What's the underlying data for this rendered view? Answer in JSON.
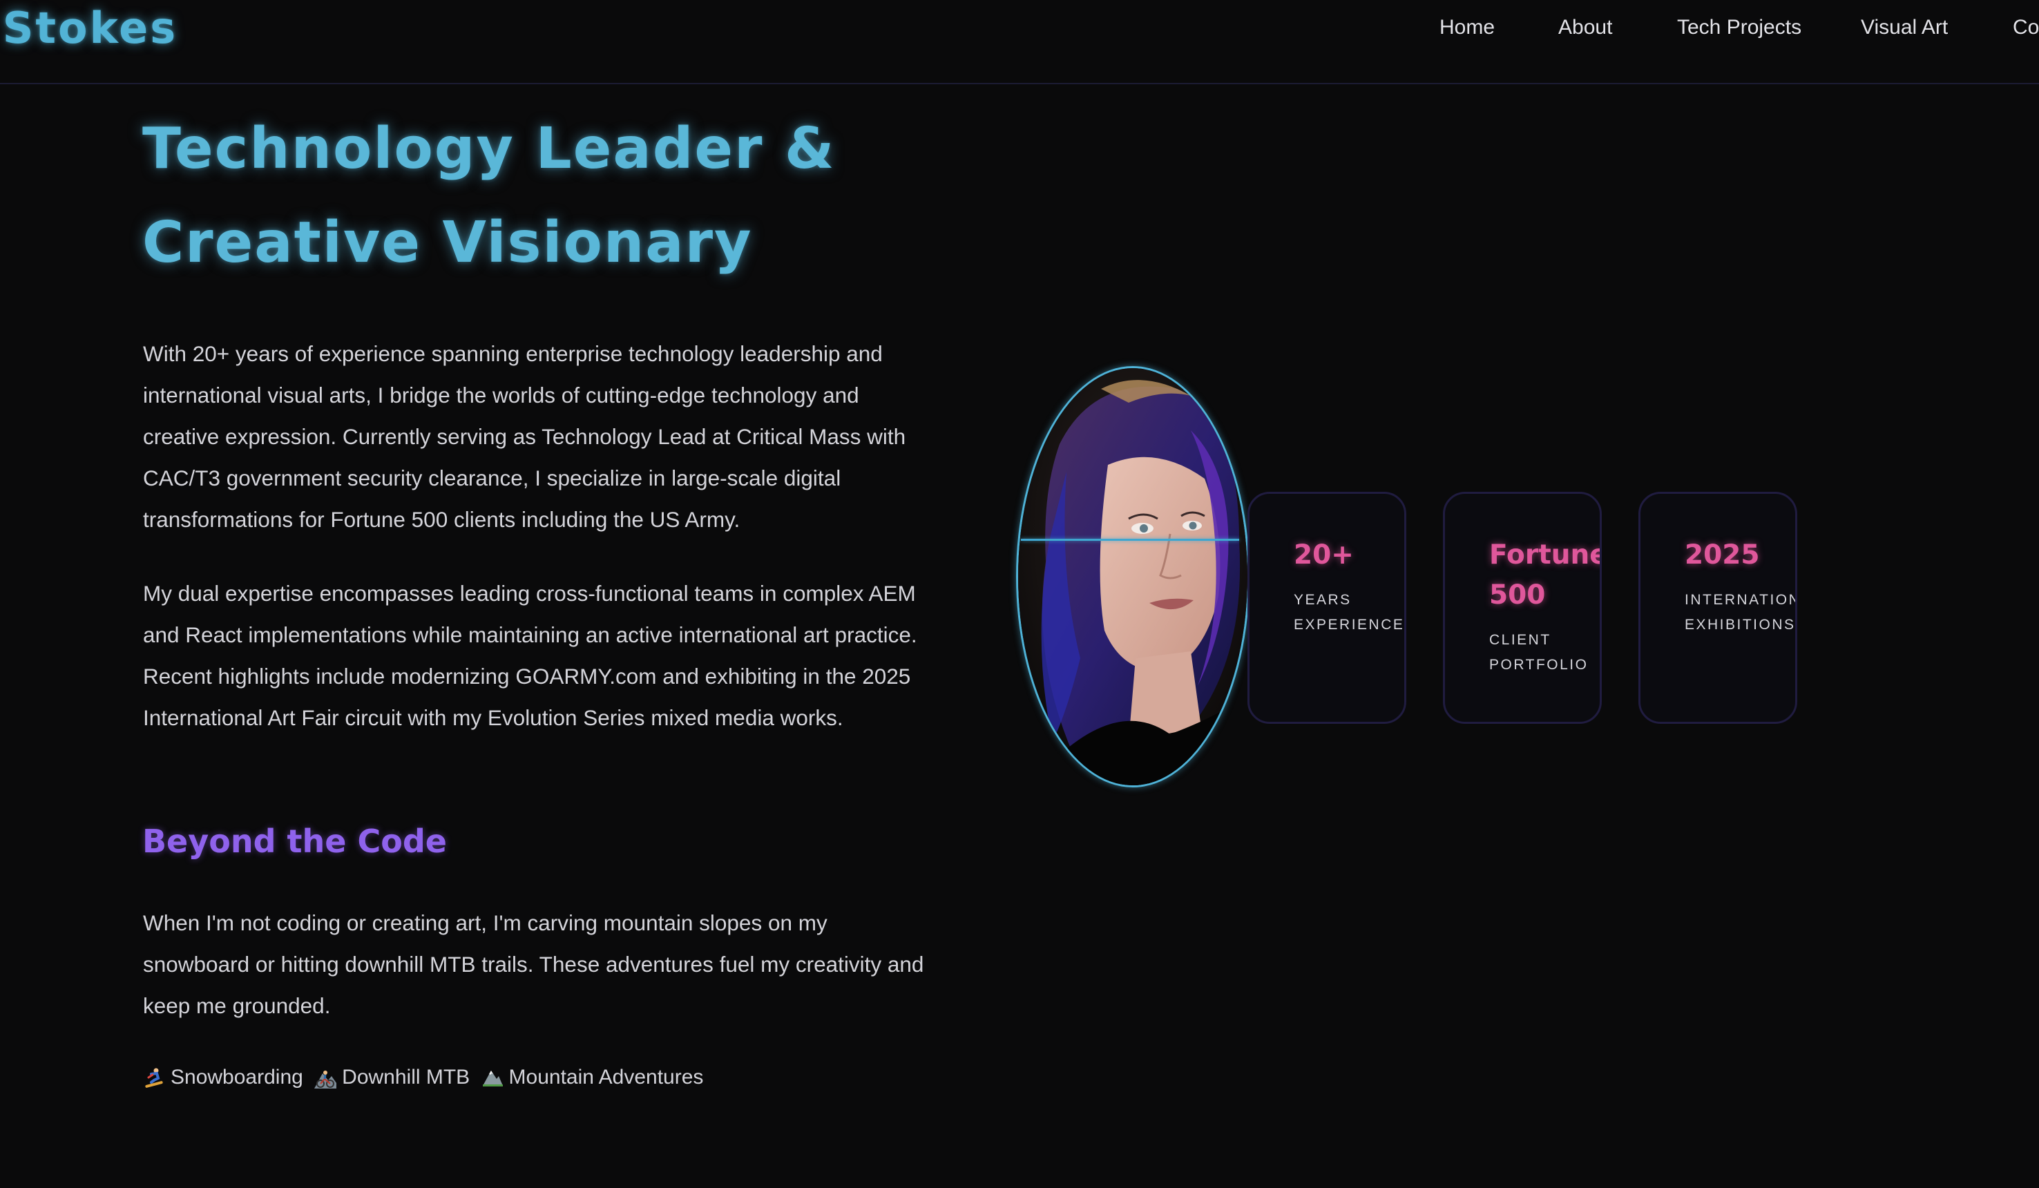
{
  "nav": {
    "brand": "n Stokes",
    "links": [
      "Home",
      "About",
      "Tech Projects",
      "Visual Art",
      "Co"
    ]
  },
  "hero": {
    "title_line1": "Technology Leader &",
    "title_line2": "Creative Visionary"
  },
  "about": {
    "paragraph1": "With 20+ years of experience spanning enterprise technology leadership and international visual arts, I bridge the worlds of cutting-edge technology and creative expression. Currently serving as Technology Lead at Critical Mass with CAC/T3 government security clearance, I specialize in large-scale digital transformations for Fortune 500 clients including the US Army.",
    "paragraph2": "My dual expertise encompasses leading cross-functional teams in complex AEM and React implementations while maintaining an active international art practice. Recent highlights include modernizing GOARMY.com and exhibiting in the 2025 International Art Fair circuit with my Evolution Series mixed media works."
  },
  "beyond": {
    "heading": "Beyond the Code",
    "paragraph": "When I'm not coding or creating art, I'm carving mountain slopes on my snowboard or hitting downhill MTB trails. These adventures fuel my creativity and keep me grounded.",
    "hobbies": [
      {
        "icon": "snowboarder-icon",
        "label": "Snowboarding"
      },
      {
        "icon": "mountain-biker-icon",
        "label": "Downhill MTB"
      },
      {
        "icon": "mountain-icon",
        "label": "Mountain Adventures"
      }
    ]
  },
  "stats": [
    {
      "value": "20+",
      "label": "YEARS\nEXPERIENCE"
    },
    {
      "value": "Fortune\n500",
      "label": "CLIENT\nPORTFOLIO"
    },
    {
      "value": "2025",
      "label": "INTERNATIONAL\nEXHIBITIONS"
    }
  ],
  "colors": {
    "background": "#0a0a0b",
    "accent_cyan": "#52b3d6",
    "accent_purple": "#8f62ec",
    "accent_pink": "#e0579b",
    "card_border": "#201c40",
    "body_text": "#d4d4da"
  }
}
